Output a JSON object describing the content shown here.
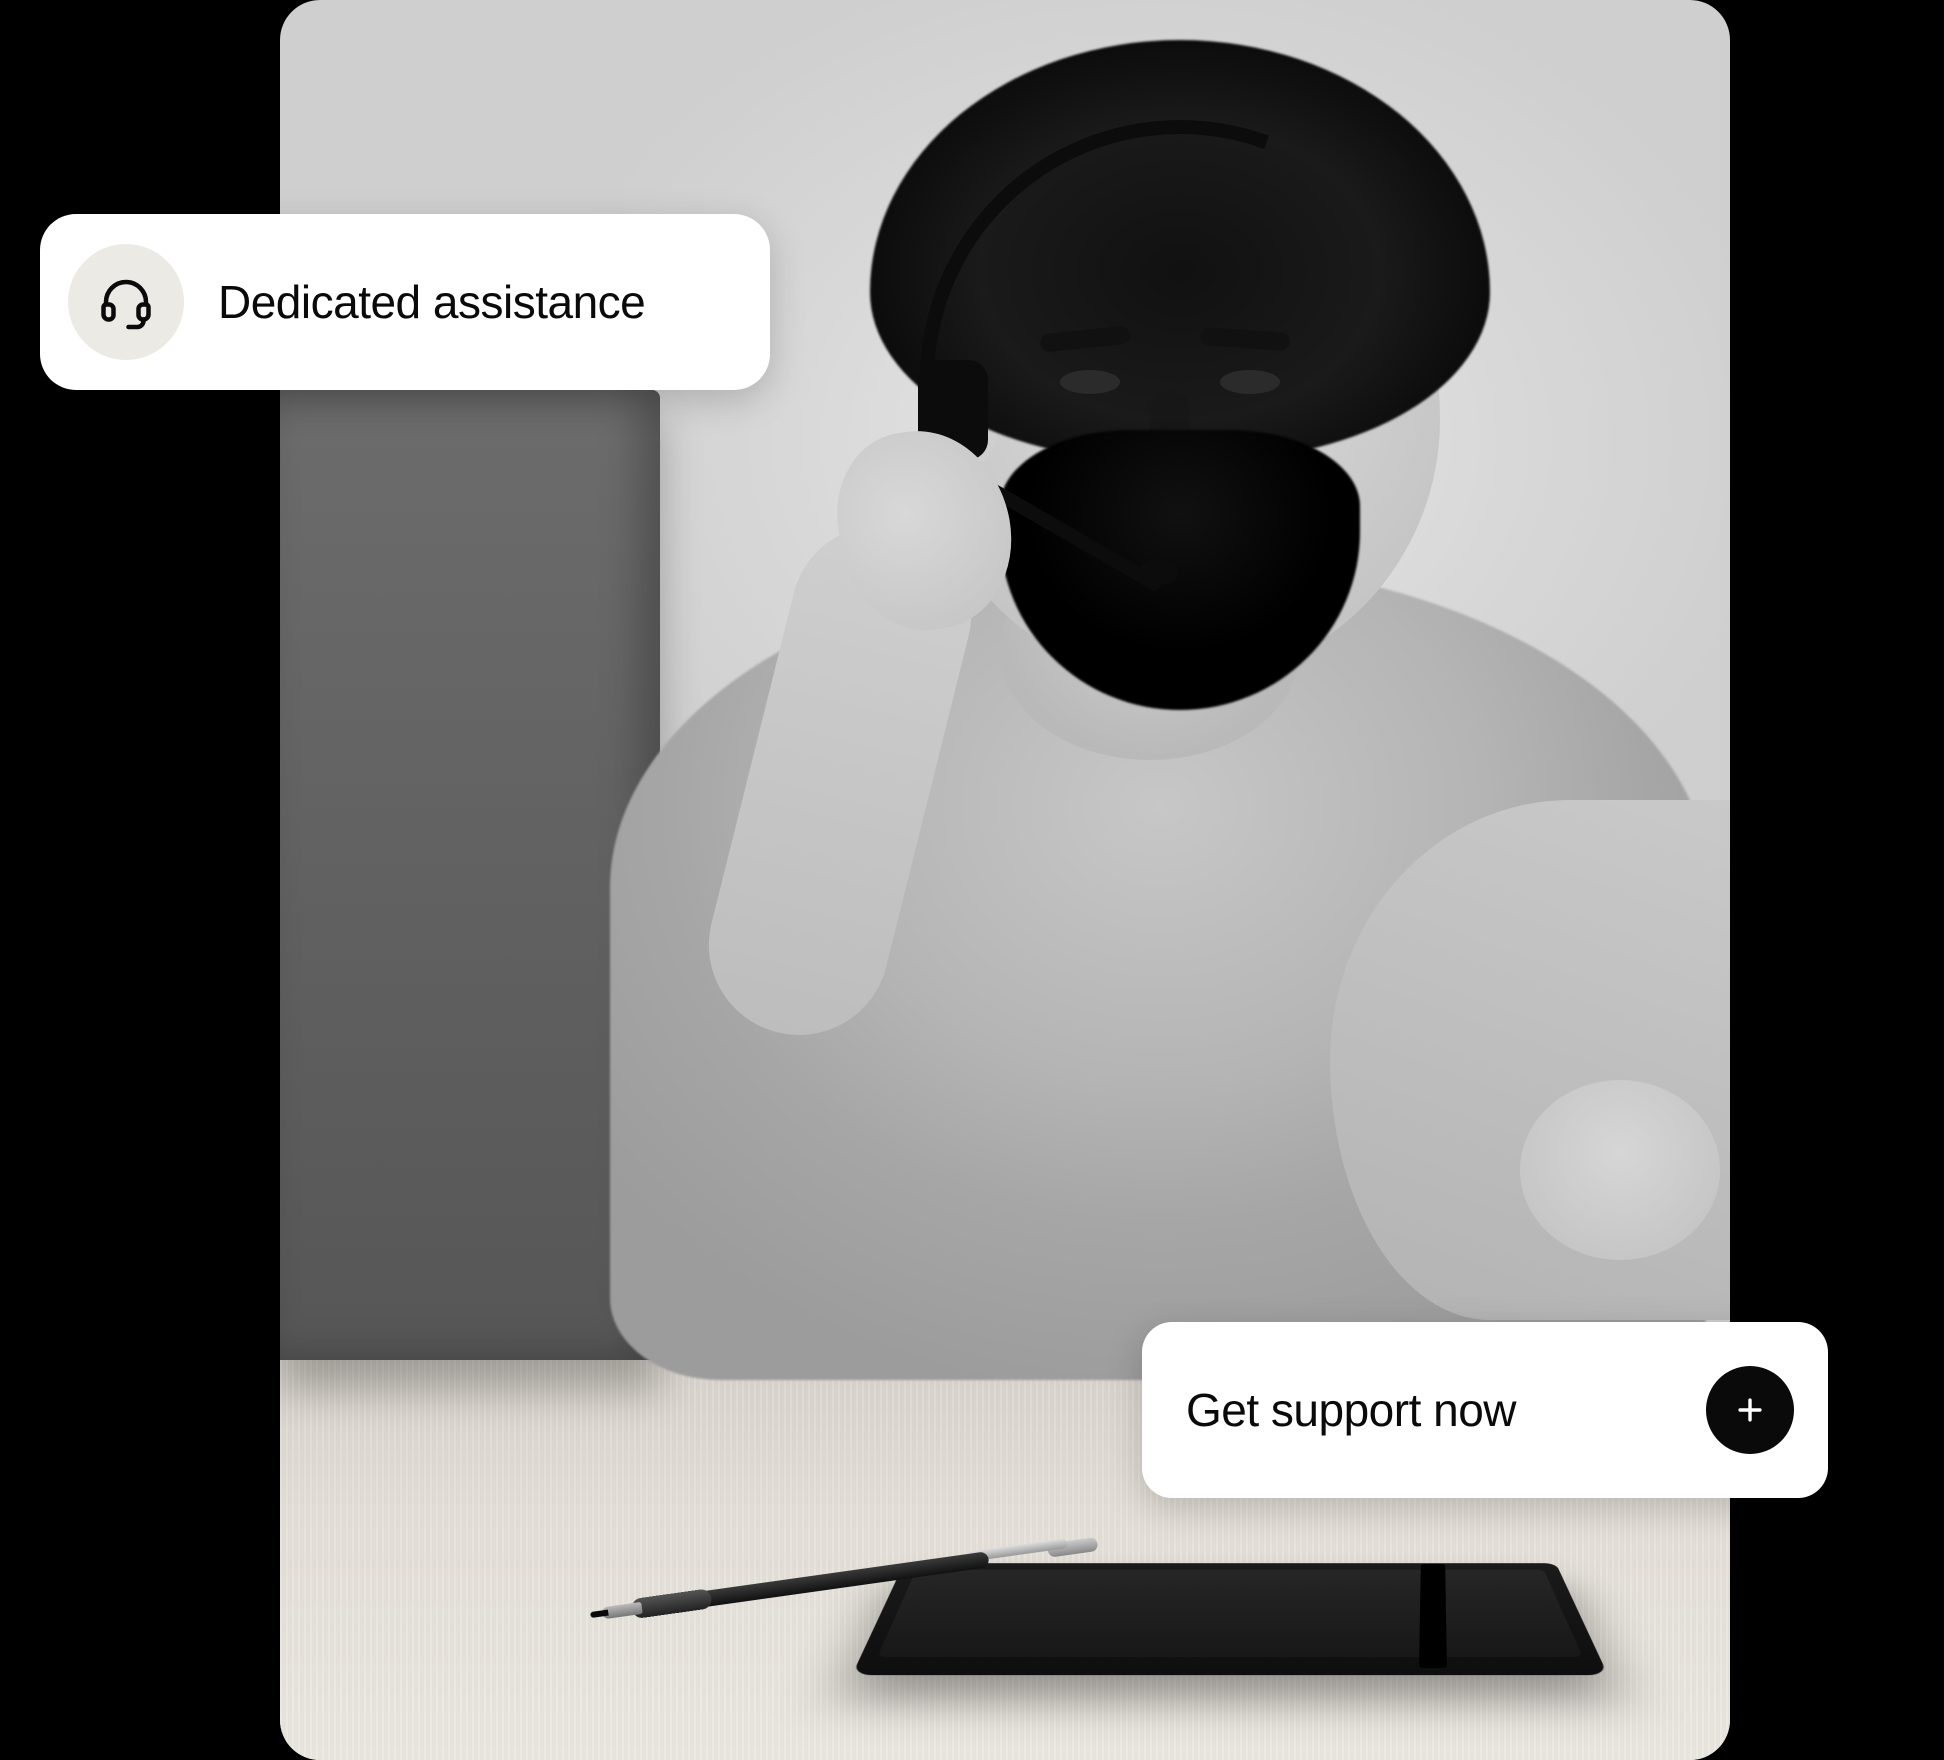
{
  "badge": {
    "label": "Dedicated assistance",
    "icon": "headset-icon"
  },
  "cta": {
    "label": "Get support now",
    "icon": "plus-icon"
  }
}
